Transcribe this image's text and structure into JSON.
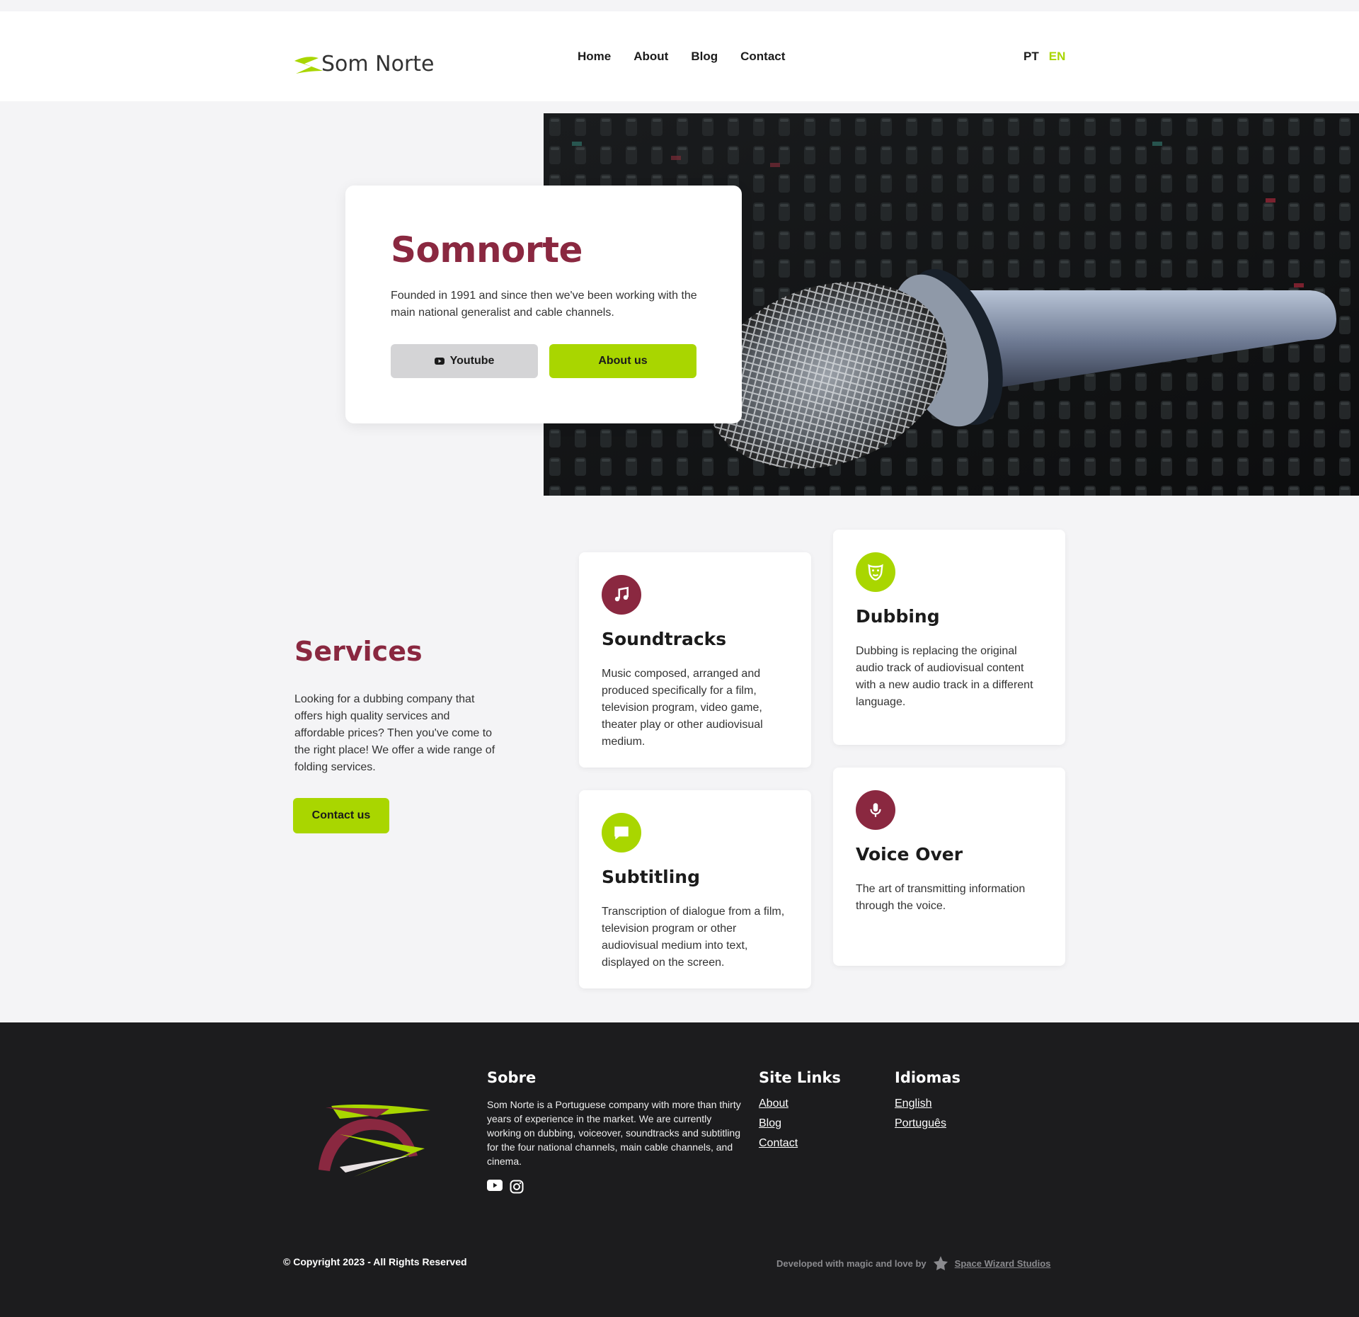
{
  "header": {
    "logo_text": "Som Norte",
    "nav": [
      {
        "label": "Home"
      },
      {
        "label": "About"
      },
      {
        "label": "Blog"
      },
      {
        "label": "Contact"
      }
    ],
    "lang": {
      "pt": "PT",
      "en": "EN"
    }
  },
  "hero": {
    "title": "Somnorte",
    "description": "Founded in 1991 and since then we've been working with the main national generalist and cable channels.",
    "youtube_label": "Youtube",
    "about_label": "About us"
  },
  "services": {
    "title": "Services",
    "description": "Looking for a dubbing company that offers high quality services and affordable prices? Then you've come to the right place! We offer a wide range of folding services.",
    "contact_label": "Contact us",
    "cards": [
      {
        "title": "Soundtracks",
        "text": "Music composed, arranged and produced specifically for a film, television program, video game, theater play or other audiovisual medium.",
        "icon": "music-note-icon",
        "color": "#8a2840"
      },
      {
        "title": "Dubbing",
        "text": "Dubbing is replacing the original audio track of audiovisual content with a new audio track in a different language.",
        "icon": "theater-mask-icon",
        "color": "#a9d600"
      },
      {
        "title": "Subtitling",
        "text": "Transcription of dialogue from a film, television program or other audiovisual medium into text, displayed on the screen.",
        "icon": "chat-bubble-icon",
        "color": "#a9d600"
      },
      {
        "title": "Voice Over",
        "text": "The art of transmitting information through the voice.",
        "icon": "microphone-icon",
        "color": "#8a2840"
      }
    ]
  },
  "footer": {
    "sobre_title": "Sobre",
    "sobre_text": "Som Norte is a Portuguese company with more than thirty years of experience in the market. We are currently working on dubbing, voiceover, soundtracks and subtitling for the four national channels, main cable channels, and cinema.",
    "links_title": "Site Links",
    "links": [
      {
        "label": "About"
      },
      {
        "label": "Blog"
      },
      {
        "label": "Contact"
      }
    ],
    "lang_title": "Idiomas",
    "languages": [
      {
        "label": "English"
      },
      {
        "label": "Português"
      }
    ],
    "copyright": "© Copyright 2023 - All Rights Reserved",
    "dev_text": "Developed with magic and love by",
    "dev_studio": "Space Wizard Studios"
  },
  "colors": {
    "brand": "#8a2840",
    "accent": "#a9d600",
    "footer_bg": "#1c1c1e"
  }
}
